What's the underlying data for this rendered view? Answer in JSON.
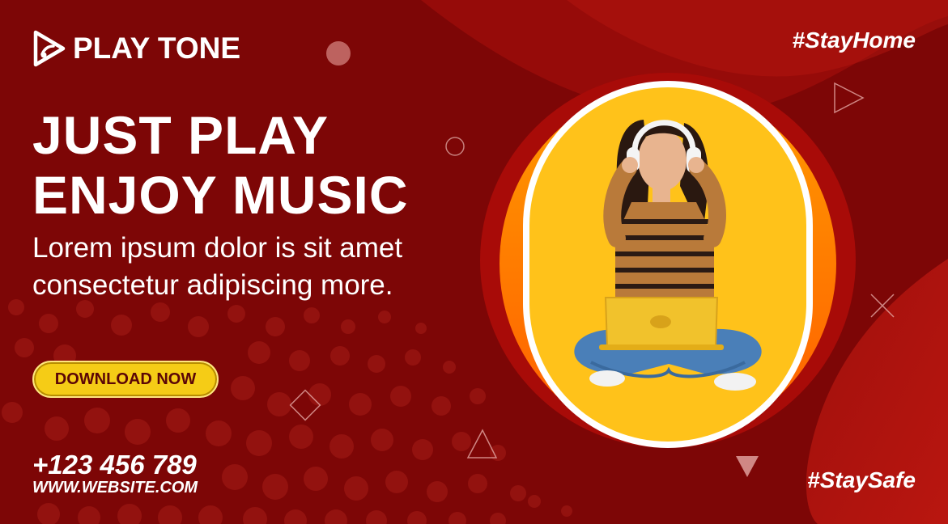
{
  "brand": {
    "name": "PLAY TONE",
    "logo_icon": "play-logo-icon"
  },
  "hashtags": {
    "top": "#StayHome",
    "bottom": "#StaySafe"
  },
  "headline": {
    "line1": "JUST PLAY",
    "line2": "ENJOY MUSIC"
  },
  "subtext": {
    "line1": "Lorem ipsum dolor is sit amet",
    "line2": "consectetur adipiscing more."
  },
  "cta": {
    "label": "DOWNLOAD NOW"
  },
  "contact": {
    "phone": "+123 456 789",
    "website": "WWW.WEBSITE.COM"
  },
  "colors": {
    "background": "#7d0606",
    "accent_yellow": "#f5cc16",
    "ring_orange": "#ff7a00",
    "photo_bg": "#ffc21a"
  }
}
